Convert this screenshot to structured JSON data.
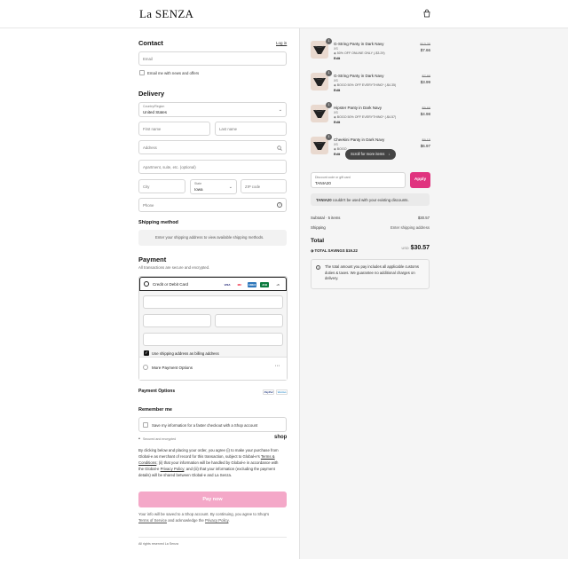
{
  "header": {
    "logo": "La SENZA",
    "bag_icon": "shopping-bag-icon"
  },
  "contact": {
    "title": "Contact",
    "login": "Log in",
    "email_placeholder": "Email",
    "news_label": "Email me with news and offers"
  },
  "delivery": {
    "title": "Delivery",
    "country_label": "Country/Region",
    "country_value": "United States",
    "first_name": "First name",
    "last_name": "Last name",
    "address": "Address",
    "apartment": "Apartment, suite, etc. (optional)",
    "city": "City",
    "state_label": "State",
    "state_value": "Iowa",
    "zip": "ZIP code",
    "phone": "Phone"
  },
  "shipping_method": {
    "title": "Shipping method",
    "message": "Enter your shipping address to view available shipping methods."
  },
  "payment": {
    "title": "Payment",
    "subtitle": "All transactions are secure and encrypted.",
    "card_option": "Credit or Debit Card",
    "card_brands": [
      "VISA",
      "MC",
      "AMEX",
      "JCB",
      "+5"
    ],
    "billing_label": "Use shipping address as billing address",
    "more_options": "More Payment Options",
    "more_icon": "ellipsis-icon"
  },
  "payment_options": {
    "title": "Payment Options",
    "badges": [
      "PayPal",
      "Venmo"
    ]
  },
  "remember": {
    "title": "Remember me",
    "save_label": "Save my information for a faster checkout with a Shop account",
    "secure_note": "Secured and encrypted",
    "shop_logo": "shop"
  },
  "legal": {
    "line1": "By clicking below and placing your order, you agree (i) to make your purchase from",
    "line2": "Global-e as merchant of record for this transaction, subject to Global-e's",
    "terms_link": "Terms &",
    "line3_link": "Conditions",
    "line3": "; (ii) that your information will be handled by Global-e in accordance with",
    "line4a": "the Global-e",
    "privacy_link": "Privacy Policy",
    "line4b": "; and (iii) that your information (excluding the payment",
    "line5": "details) will be shared between Global-e and La Senza."
  },
  "pay_button": "Pay now",
  "footer": {
    "line1": "Your info will be saved to a Shop account. By continuing, you agree to Shop's",
    "terms": "Terms of Service",
    "and": "and acknowledge the",
    "privacy": "Privacy Policy",
    "rights": "All rights reserved La Senza"
  },
  "cart": {
    "items": [
      {
        "qty": "1",
        "name": "G-String Panty in Dark Navy",
        "variant": "XS",
        "discount": "50% OFF ONLINE ONLY (-$3.29)",
        "edit": "Edit",
        "old": "$13.25",
        "new": "$7.66"
      },
      {
        "qty": "1",
        "name": "G-String Panty in Dark Navy",
        "variant": "XS",
        "discount": "BOGO 50% OFF EVERYTHING* (-$4.35)",
        "edit": "Edit",
        "old": "$7.99",
        "new": "$3.99"
      },
      {
        "qty": "1",
        "name": "Hipster Panty in Dark Navy",
        "variant": "XS",
        "discount": "BOGO 50% OFF EVERYTHING* (-$4.57)",
        "edit": "Edit",
        "old": "$9.66",
        "new": "$4.98"
      },
      {
        "qty": "1",
        "name": "Cheekini Panty in Dark Navy",
        "variant": "XS",
        "discount": "BOGO",
        "edit": "Edit",
        "old": "$9.15",
        "new": "$6.97"
      }
    ],
    "scroll_pill": "Scroll for more items",
    "discount_label": "Discount code or gift card",
    "discount_value": "TANIA20",
    "apply": "Apply",
    "error_code": "TANIA20",
    "error_text": "couldn't be used with your existing discounts.",
    "subtotal_label": "Subtotal · 5 items",
    "subtotal_value": "$30.57",
    "shipping_label": "Shipping",
    "shipping_value": "Enter shipping address",
    "total_label": "Total",
    "currency": "USD",
    "total_value": "$30.57",
    "savings_label": "TOTAL SAVINGS",
    "savings_value": "$19.22",
    "duties_note": "The total amount you pay includes all applicable customs duties & taxes. We guarantee no additional charges on delivery."
  },
  "colors": {
    "accent": "#e0337f",
    "pay_button": "#f4a8c8",
    "card_visa": "#1a1f71",
    "card_mc": "#eb001b",
    "card_amex": "#2e77bb",
    "card_jcb": "#0b7a3e"
  }
}
